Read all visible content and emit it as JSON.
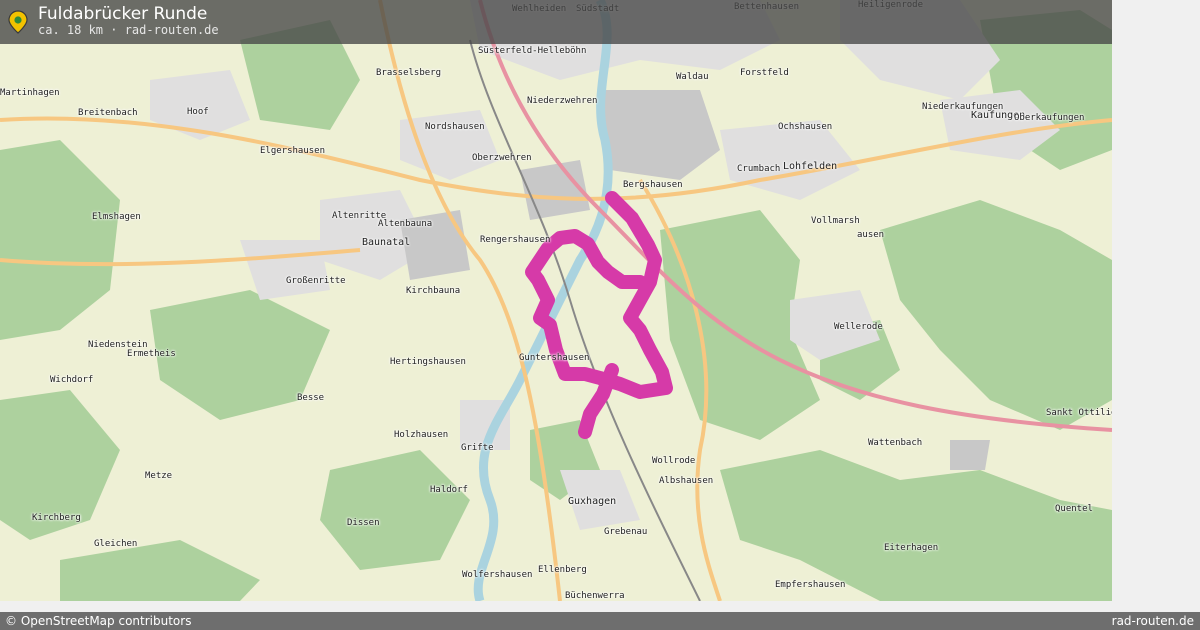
{
  "header": {
    "title": "Fuldabrücker Runde",
    "subtitle": "ca. 18 km · rad-routen.de",
    "icon": "map-pin-icon"
  },
  "footer": {
    "attribution": "© OpenStreetMap contributors",
    "brand": "rad-routen.de"
  },
  "colors": {
    "route": "#d63aa8",
    "forest": "#add19e",
    "residential": "#e0dfdf",
    "industrial": "#c8c8c8",
    "water": "#aad3df",
    "farmland": "#eef0d5",
    "background": "#f5efd9"
  },
  "places": [
    {
      "name": "Wehlheiden"
    },
    {
      "name": "Südstadt"
    },
    {
      "name": "Bettenhausen"
    },
    {
      "name": "Heiligenrode"
    },
    {
      "name": "Süsterfeld-Helleböhn"
    },
    {
      "name": "Brasselsberg"
    },
    {
      "name": "Waldau"
    },
    {
      "name": "Forstfeld"
    },
    {
      "name": "Martinhagen"
    },
    {
      "name": "Niederzwehren"
    },
    {
      "name": "Niederkaufungen"
    },
    {
      "name": "Breitenbach"
    },
    {
      "name": "Hoof"
    },
    {
      "name": "Kaufungen"
    },
    {
      "name": "Oberkaufungen"
    },
    {
      "name": "Nordshausen"
    },
    {
      "name": "Ochshausen"
    },
    {
      "name": "Elgershausen"
    },
    {
      "name": "Oberzwehren"
    },
    {
      "name": "Crumbach"
    },
    {
      "name": "Lohfelden"
    },
    {
      "name": "Bergshausen"
    },
    {
      "name": "Elmshagen"
    },
    {
      "name": "Altenritte"
    },
    {
      "name": "Altenbauna"
    },
    {
      "name": "Vollmarsh"
    },
    {
      "name": "Rengershausen"
    },
    {
      "name": "Baunatal"
    },
    {
      "name": "ausen"
    },
    {
      "name": "Großenritte"
    },
    {
      "name": "Kirchbauna"
    },
    {
      "name": "Wellerode"
    },
    {
      "name": "Niedenstein"
    },
    {
      "name": "Ermetheis"
    },
    {
      "name": "Guntershausen"
    },
    {
      "name": "Hertingshausen"
    },
    {
      "name": "Wichdorf"
    },
    {
      "name": "Besse"
    },
    {
      "name": "Sankt Ottilien"
    },
    {
      "name": "Holzhausen"
    },
    {
      "name": "Grifte"
    },
    {
      "name": "Wattenbach"
    },
    {
      "name": "Wollrode"
    },
    {
      "name": "Albshausen"
    },
    {
      "name": "Metze"
    },
    {
      "name": "Haldorf"
    },
    {
      "name": "Guxhagen"
    },
    {
      "name": "Kirchberg"
    },
    {
      "name": "Quentel"
    },
    {
      "name": "Dissen"
    },
    {
      "name": "Grebenau"
    },
    {
      "name": "Gleichen"
    },
    {
      "name": "Eiterhagen"
    },
    {
      "name": "Ellenberg"
    },
    {
      "name": "Wolfershausen"
    },
    {
      "name": "Empfershausen"
    },
    {
      "name": "Büchenwerra"
    }
  ]
}
